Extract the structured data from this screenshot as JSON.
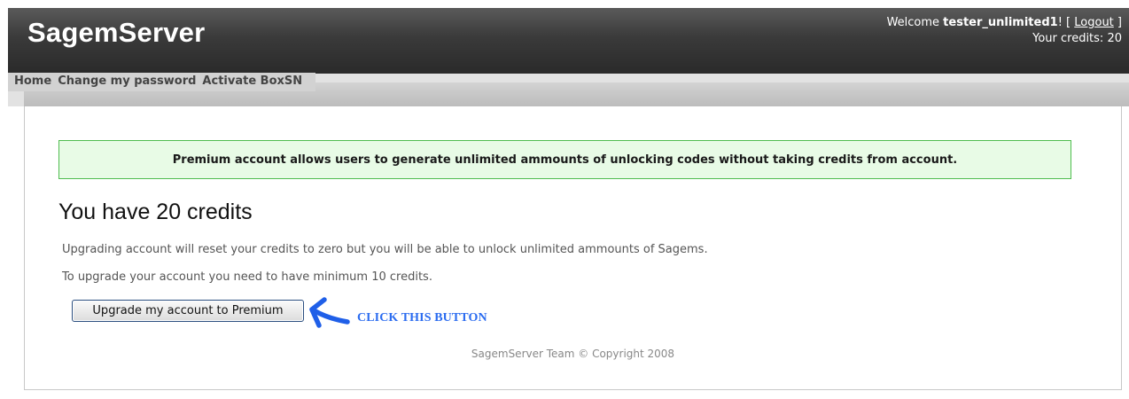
{
  "header": {
    "logo": "SagemServer",
    "welcome_prefix": "Welcome ",
    "username": "tester_unlimited1",
    "welcome_suffix": "! [ ",
    "logout_label": "Logout",
    "bracket_close": " ]",
    "credits_line": "Your credits: 20"
  },
  "nav": {
    "items": [
      "Home",
      "Change my password",
      "Activate BoxSN"
    ]
  },
  "main": {
    "notice": "Premium account allows users to generate unlimited ammounts of unlocking codes without taking credits from account.",
    "heading": "You have 20 credits",
    "info1": "Upgrading account will reset your credits to zero but you will be able to unlock unlimited ammounts of Sagems.",
    "info2": "To upgrade your account you need to have minimum 10 credits.",
    "upgrade_button": "Upgrade my account to Premium",
    "annotation": "CLICK THIS BUTTON",
    "footer": "SagemServer Team © Copyright 2008"
  },
  "colors": {
    "header_bg": "#333333",
    "notice_bg": "#e8fbe6",
    "notice_border": "#4fbd4f",
    "annotation": "#2b6cf0"
  },
  "icons": {
    "annotation_arrow": "arrow-pointing-left-icon"
  }
}
